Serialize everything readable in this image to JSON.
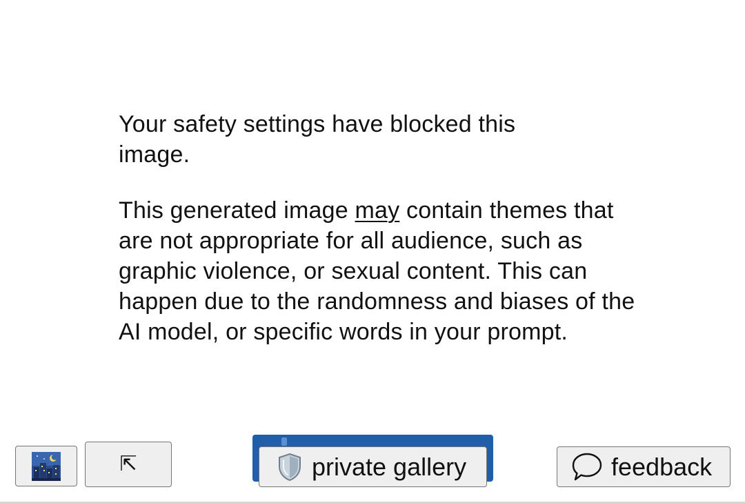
{
  "message": {
    "heading": "Your safety settings have blocked this image.",
    "body_before": "This generated image ",
    "body_emphasis": "may",
    "body_after": " contain themes that are not appropriate for all audience, such as graphic violence, or sexual content. This can happen due to the randomness and biases of the AI model, or specific words in your prompt."
  },
  "toolbar": {
    "image_button_icon": "night-city-icon",
    "expand_button_icon": "arrow-up-left-icon",
    "expand_glyph": "⇱",
    "gallery_label": "private gallery",
    "gallery_icon": "shield-icon",
    "feedback_label": "feedback",
    "feedback_icon": "speech-bubble-icon"
  },
  "colors": {
    "gallery_highlight": "#1f5faa",
    "button_bg": "#efefef",
    "button_border": "#767676"
  }
}
